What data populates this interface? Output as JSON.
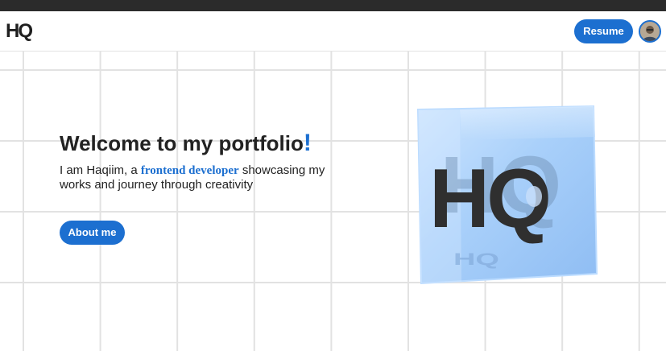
{
  "header": {
    "logo_text": "HQ",
    "resume_label": "Resume",
    "avatar_alt": "profile avatar"
  },
  "hero": {
    "title_main": "Welcome to my portfolio",
    "title_exclaim": "!",
    "desc_before": "I am Haqiim, a ",
    "desc_role": "frontend developer",
    "desc_after": " showcasing my works and journey through creativity",
    "about_label": "About me"
  },
  "cube": {
    "logo_text": "HQ",
    "reflection_text": "HQ"
  },
  "colors": {
    "accent": "#1c6fd0",
    "top_strip": "#2b2b2b",
    "text": "#222222",
    "grid_line": "#e2e2e2",
    "ice": "#a9d0fa"
  },
  "icons": {
    "avatar": "user-avatar-icon",
    "cube": "ice-cube-logo-icon"
  }
}
